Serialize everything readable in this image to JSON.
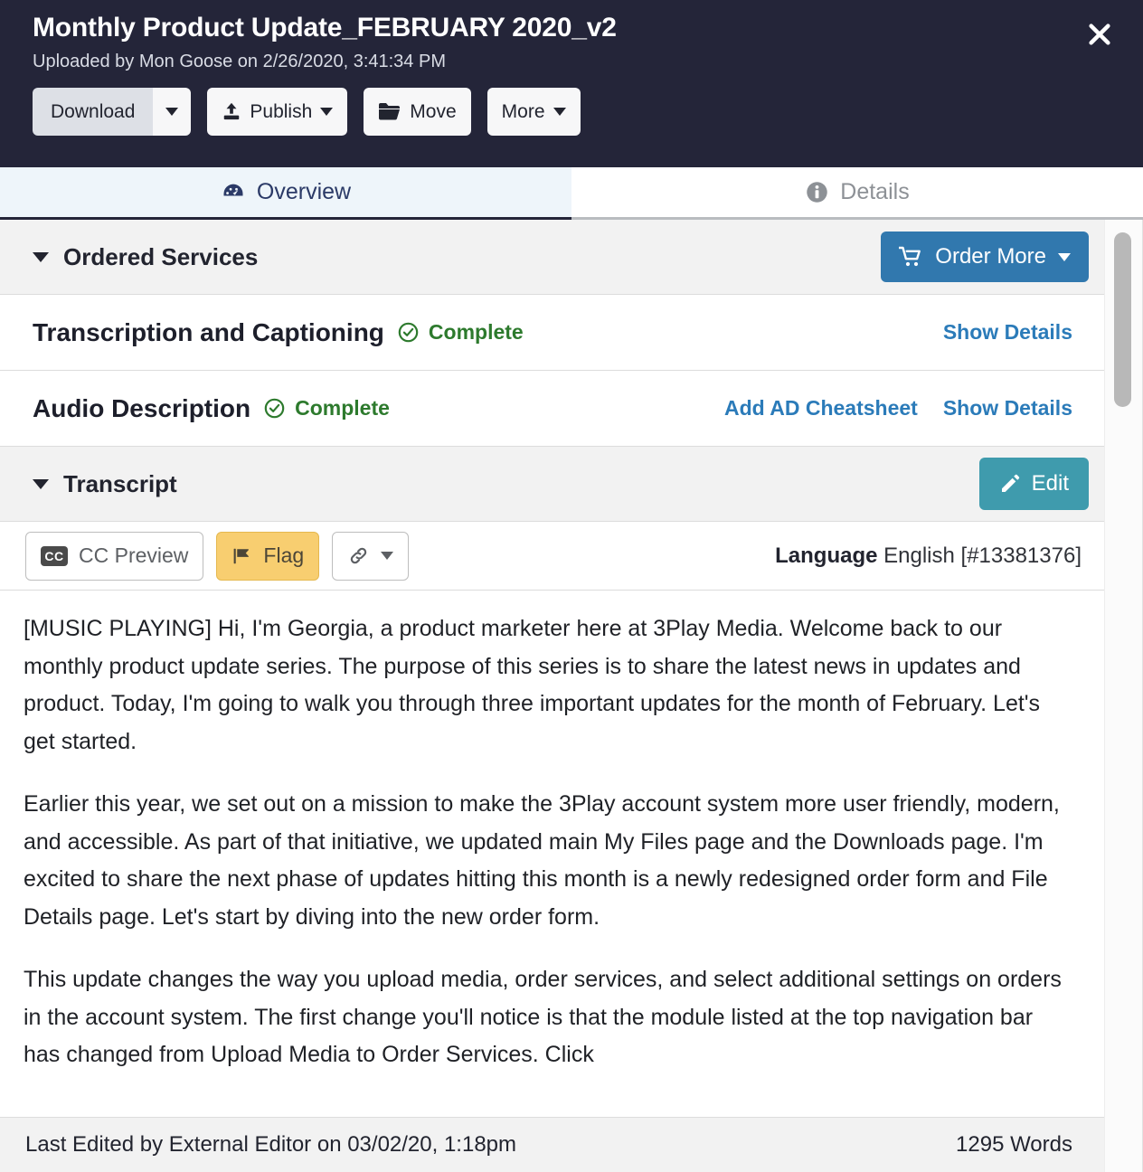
{
  "header": {
    "title": "Monthly Product Update_FEBRUARY 2020_v2",
    "subtitle": "Uploaded by Mon Goose on 2/26/2020, 3:41:34 PM",
    "close_label": "Close",
    "actions": {
      "download": "Download",
      "publish": "Publish",
      "move": "Move",
      "more": "More"
    },
    "colors": {
      "background": "#242539",
      "subtitle_text": "#d9dce5"
    }
  },
  "tabs": [
    {
      "label": "Overview",
      "icon": "dashboard-icon",
      "active": true
    },
    {
      "label": "Details",
      "icon": "info-circle-icon",
      "active": false
    }
  ],
  "ordered_services": {
    "section_label": "Ordered Services",
    "order_more_label": "Order More",
    "order_more_color": "#3178ae",
    "rows": [
      {
        "name": "Transcription and Captioning",
        "status": "Complete",
        "status_color": "#2d7a2d",
        "links": [
          "Show Details"
        ]
      },
      {
        "name": "Audio Description",
        "status": "Complete",
        "status_color": "#2d7a2d",
        "links": [
          "Add AD Cheatsheet",
          "Show Details"
        ]
      }
    ]
  },
  "transcript": {
    "section_label": "Transcript",
    "edit_label": "Edit",
    "edit_color": "#3f9bad",
    "toolbar": {
      "cc_preview_label": "CC Preview",
      "cc_badge": "CC",
      "flag_label": "Flag",
      "flag_color": "#f8ce70",
      "link_menu_label": "",
      "language_label": "Language",
      "language_value": "English [#13381376]"
    },
    "paragraphs": [
      "[MUSIC PLAYING] Hi, I'm Georgia, a product marketer here at 3Play Media. Welcome back to our monthly product update series. The purpose of this series is to share the latest news in updates and product. Today, I'm going to walk you through three important updates for the month of February. Let's get started.",
      "Earlier this year, we set out on a mission to make the 3Play account system more user friendly, modern, and accessible. As part of that initiative, we updated main My Files page and the Downloads page. I'm excited to share the next phase of updates hitting this month is a newly redesigned order form and File Details page. Let's start by diving into the new order form.",
      "This update changes the way you upload media, order services, and select additional settings on orders in the account system. The first change you'll notice is that the module listed at the top navigation bar has changed from Upload Media to Order Services. Click"
    ]
  },
  "footer": {
    "last_edited": "Last Edited by External Editor on 03/02/20, 1:18pm",
    "word_count": "1295 Words"
  }
}
